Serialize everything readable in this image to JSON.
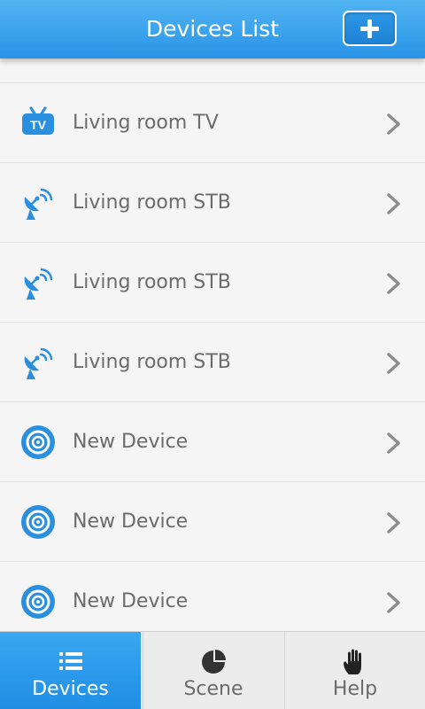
{
  "header": {
    "title": "Devices List",
    "add_button_icon": "plus-icon"
  },
  "devices": [
    {
      "name": "Living room TV",
      "icon": "tv-icon"
    },
    {
      "name": "Living room STB",
      "icon": "satellite-dish-icon"
    },
    {
      "name": "Living room STB",
      "icon": "satellite-dish-icon"
    },
    {
      "name": "Living room STB",
      "icon": "satellite-dish-icon"
    },
    {
      "name": "New Device",
      "icon": "speaker-icon"
    },
    {
      "name": "New Device",
      "icon": "speaker-icon"
    },
    {
      "name": "New Device",
      "icon": "speaker-icon"
    }
  ],
  "tabs": [
    {
      "label": "Devices",
      "icon": "list-icon",
      "selected": true
    },
    {
      "label": "Scene",
      "icon": "pie-chart-icon",
      "selected": false
    },
    {
      "label": "Help",
      "icon": "hand-icon",
      "selected": false
    }
  ],
  "colors": {
    "accent": "#2994e6",
    "text": "#6b6b6b",
    "background": "#f5f5f5"
  }
}
